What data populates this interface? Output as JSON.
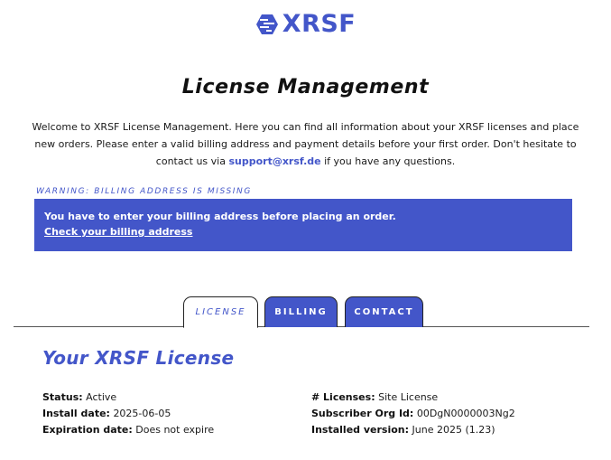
{
  "brand": {
    "logo_text": "XRSF",
    "accent_color": "#4356c9",
    "icon": "hexagon-logo-icon"
  },
  "page": {
    "title": "License Management",
    "intro_before_link": "Welcome to XRSF License Management. Here you can find all information about your XRSF licenses and place new orders. Please enter a valid billing address and payment details before your first order. Don't hesitate to contact us via ",
    "support_email": "support@xrsf.de",
    "intro_after_link": " if you have any questions."
  },
  "warning": {
    "label": "WARNING: BILLING ADDRESS IS MISSING",
    "message": "You have to enter your billing address before placing an order.",
    "link_text": "Check your billing address"
  },
  "tabs": [
    {
      "label": "LICENSE",
      "active": true
    },
    {
      "label": "BILLING",
      "active": false
    },
    {
      "label": "CONTACT",
      "active": false
    }
  ],
  "license": {
    "title": "Your XRSF License",
    "left": [
      {
        "label": "Status:",
        "value": "Active"
      },
      {
        "label": "Install date:",
        "value": "2025-06-05"
      },
      {
        "label": "Expiration date:",
        "value": "Does not expire"
      }
    ],
    "right": [
      {
        "label": "# Licenses:",
        "value": "Site License"
      },
      {
        "label": "Subscriber Org Id:",
        "value": "00DgN0000003Ng2"
      },
      {
        "label": "Installed version:",
        "value": "June 2025 (1.23)"
      }
    ]
  }
}
